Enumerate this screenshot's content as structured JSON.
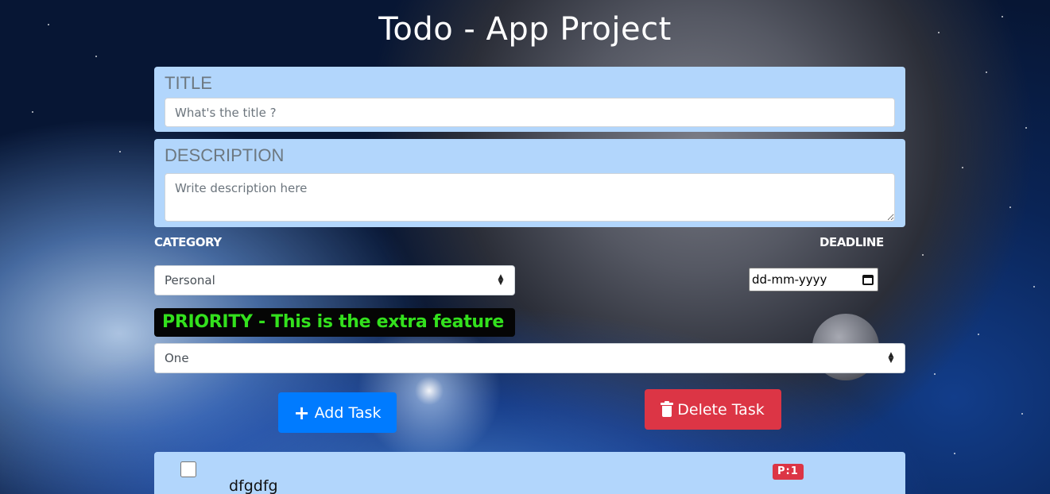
{
  "header": {
    "title": "Todo - App Project"
  },
  "title_section": {
    "label": "TITLE",
    "placeholder": "What's the title ?"
  },
  "description_section": {
    "label": "DESCRIPTION",
    "placeholder": "Write description here"
  },
  "category": {
    "label": "CATEGORY",
    "selected": "Personal"
  },
  "deadline": {
    "label": "DEADLINE",
    "value": "dd-mm-yyyy"
  },
  "priority": {
    "banner": "PRIORITY - This is the extra feature",
    "selected": "One"
  },
  "actions": {
    "add_label": "Add Task",
    "delete_label": "Delete Task"
  },
  "tasks": [
    {
      "title": "dfgdfg",
      "priority_badge": "P:1"
    }
  ],
  "icons": {
    "add": "plus-icon",
    "delete": "trash-icon",
    "select": "updown-arrows-icon",
    "date": "calendar-icon"
  },
  "colors": {
    "panel_bg": "#b2d6fc",
    "add_button": "#007bff",
    "delete_button": "#dc3545",
    "priority_text": "#33e11d",
    "badge": "#dc3545"
  }
}
